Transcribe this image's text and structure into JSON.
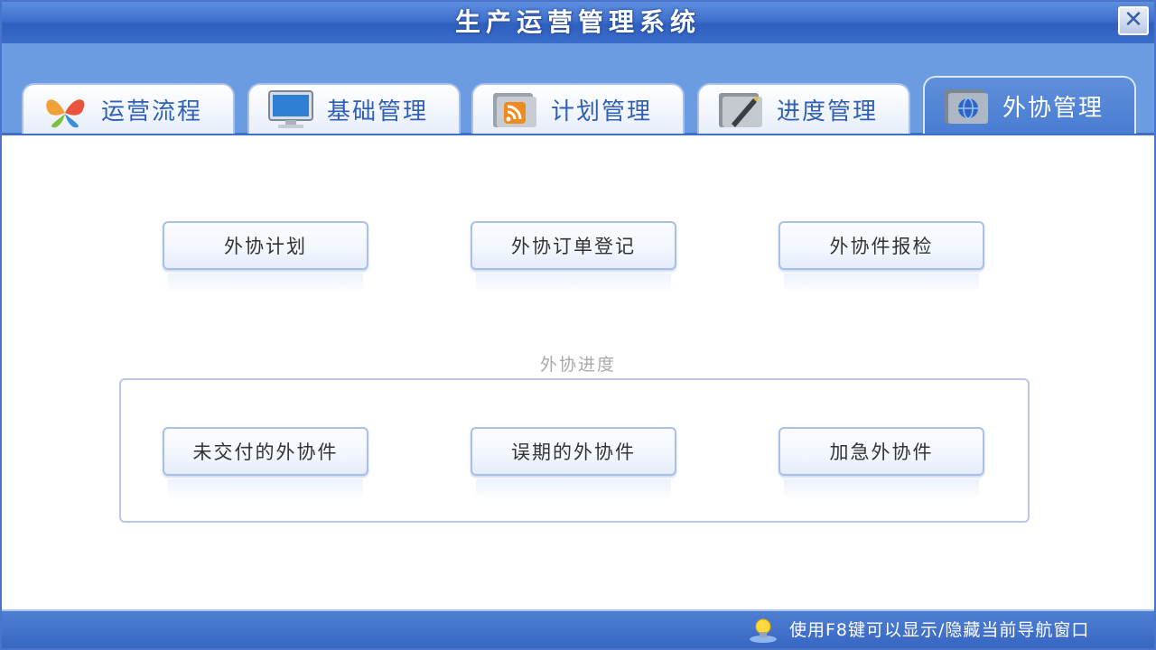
{
  "window": {
    "title": "生产运营管理系统",
    "close_label": "✕"
  },
  "tabs": [
    {
      "label": "运营流程",
      "icon": "butterfly-icon",
      "active": false
    },
    {
      "label": "基础管理",
      "icon": "monitor-icon",
      "active": false
    },
    {
      "label": "计划管理",
      "icon": "rss-folder-icon",
      "active": false
    },
    {
      "label": "进度管理",
      "icon": "pen-folder-icon",
      "active": false
    },
    {
      "label": "外协管理",
      "icon": "globe-folder-icon",
      "active": true
    }
  ],
  "main": {
    "top_buttons": [
      "外协计划",
      "外协订单登记",
      "外协件报检"
    ],
    "group": {
      "label": "外协进度",
      "buttons": [
        "未交付的外协件",
        "误期的外协件",
        "加急外协件"
      ]
    }
  },
  "status": {
    "hint": "使用F8键可以显示/隐藏当前导航窗口",
    "icon": "lightbulb-icon"
  },
  "colors": {
    "titlebar": "#3f70cc",
    "tab_band": "#6b9be0",
    "accent": "#2f5fb7",
    "statusbar": "#3766c2"
  }
}
